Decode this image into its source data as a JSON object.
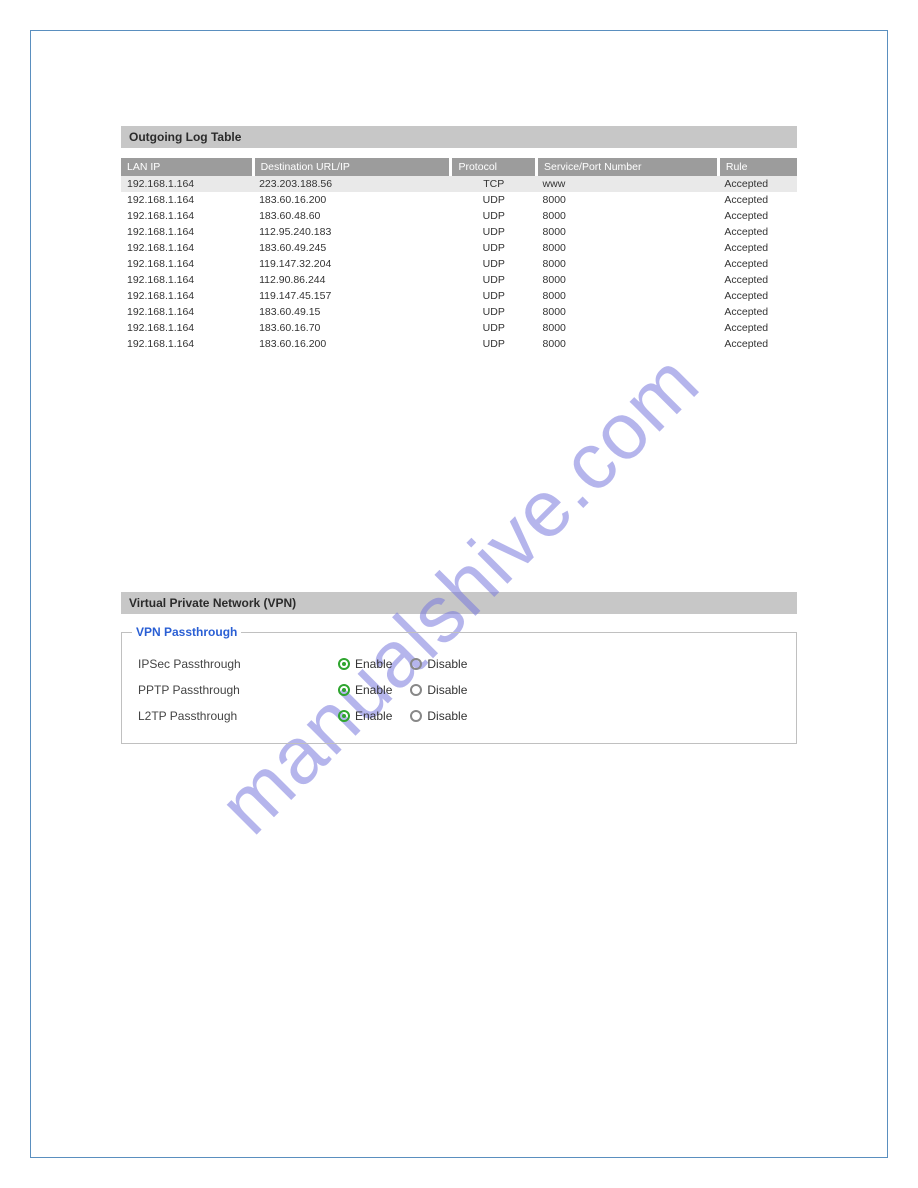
{
  "watermark": "manualshive.com",
  "log": {
    "title": "Outgoing Log Table",
    "headers": {
      "lan": "LAN IP",
      "dest": "Destination URL/IP",
      "proto": "Protocol",
      "port": "Service/Port Number",
      "rule": "Rule"
    },
    "rows": [
      {
        "lan": "192.168.1.164",
        "dest": "223.203.188.56",
        "proto": "TCP",
        "port": "www",
        "rule": "Accepted",
        "alt": true
      },
      {
        "lan": "192.168.1.164",
        "dest": "183.60.16.200",
        "proto": "UDP",
        "port": "8000",
        "rule": "Accepted"
      },
      {
        "lan": "192.168.1.164",
        "dest": "183.60.48.60",
        "proto": "UDP",
        "port": "8000",
        "rule": "Accepted"
      },
      {
        "lan": "192.168.1.164",
        "dest": "112.95.240.183",
        "proto": "UDP",
        "port": "8000",
        "rule": "Accepted"
      },
      {
        "lan": "192.168.1.164",
        "dest": "183.60.49.245",
        "proto": "UDP",
        "port": "8000",
        "rule": "Accepted"
      },
      {
        "lan": "192.168.1.164",
        "dest": "119.147.32.204",
        "proto": "UDP",
        "port": "8000",
        "rule": "Accepted"
      },
      {
        "lan": "192.168.1.164",
        "dest": "112.90.86.244",
        "proto": "UDP",
        "port": "8000",
        "rule": "Accepted"
      },
      {
        "lan": "192.168.1.164",
        "dest": "119.147.45.157",
        "proto": "UDP",
        "port": "8000",
        "rule": "Accepted"
      },
      {
        "lan": "192.168.1.164",
        "dest": "183.60.49.15",
        "proto": "UDP",
        "port": "8000",
        "rule": "Accepted"
      },
      {
        "lan": "192.168.1.164",
        "dest": "183.60.16.70",
        "proto": "UDP",
        "port": "8000",
        "rule": "Accepted"
      },
      {
        "lan": "192.168.1.164",
        "dest": "183.60.16.200",
        "proto": "UDP",
        "port": "8000",
        "rule": "Accepted"
      }
    ]
  },
  "vpn": {
    "title": "Virtual Private Network (VPN)",
    "legend": "VPN Passthrough",
    "enable_label": "Enable",
    "disable_label": "Disable",
    "rows": [
      {
        "label": "IPSec Passthrough",
        "value": "enable"
      },
      {
        "label": "PPTP Passthrough",
        "value": "enable"
      },
      {
        "label": "L2TP Passthrough",
        "value": "enable"
      }
    ]
  }
}
